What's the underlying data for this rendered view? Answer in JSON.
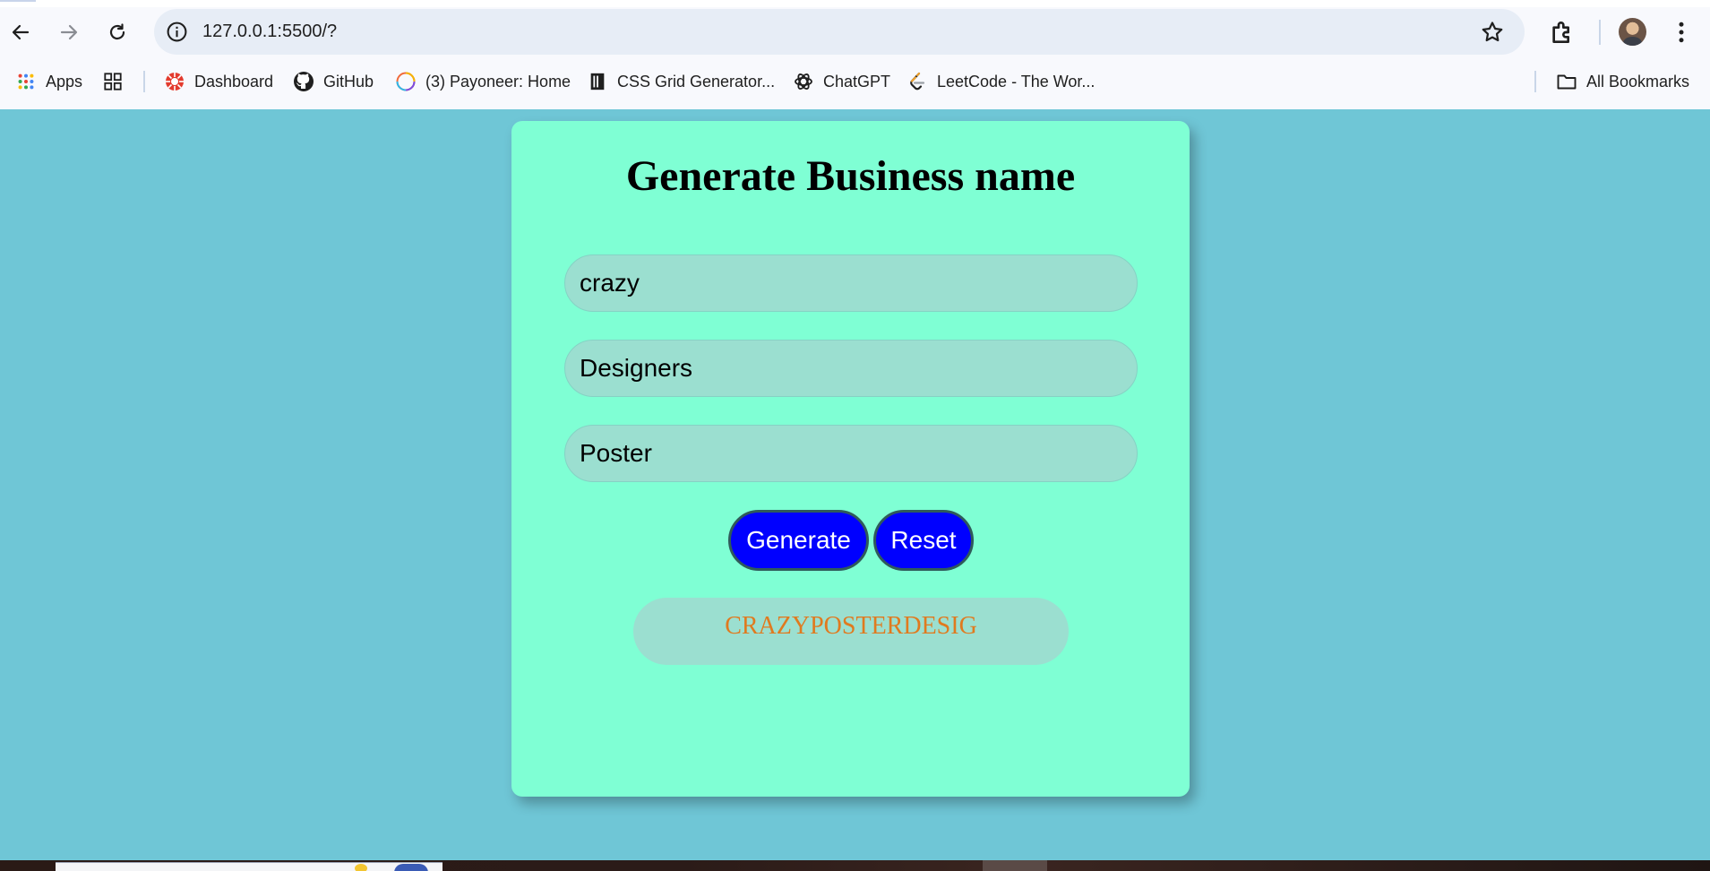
{
  "browser": {
    "url": "127.0.0.1:5500/?",
    "bookmarks": [
      {
        "label": "Apps",
        "icon": "apps-grid-icon"
      },
      {
        "label": "",
        "icon": "tab-groups-icon"
      },
      {
        "label": "Dashboard",
        "icon": "dashboard-icon"
      },
      {
        "label": "GitHub",
        "icon": "github-icon"
      },
      {
        "label": "(3) Payoneer: Home",
        "icon": "payoneer-icon"
      },
      {
        "label": "CSS Grid Generator...",
        "icon": "css-grid-icon"
      },
      {
        "label": "ChatGPT",
        "icon": "chatgpt-icon"
      },
      {
        "label": "LeetCode - The Wor...",
        "icon": "leetcode-icon"
      }
    ],
    "all_bookmarks_label": "All Bookmarks"
  },
  "app": {
    "title": "Generate Business name",
    "inputs": [
      {
        "value": "crazy"
      },
      {
        "value": "Designers"
      },
      {
        "value": "Poster"
      }
    ],
    "generate_label": "Generate",
    "reset_label": "Reset",
    "result": "CRAZYPOSTERDESIG"
  },
  "colors": {
    "page_bg": "#6fc6d6",
    "card_bg": "#7fffd4",
    "field_bg": "#9bdfd0",
    "button_bg": "#0000ff",
    "result_text": "#e07a1f"
  }
}
